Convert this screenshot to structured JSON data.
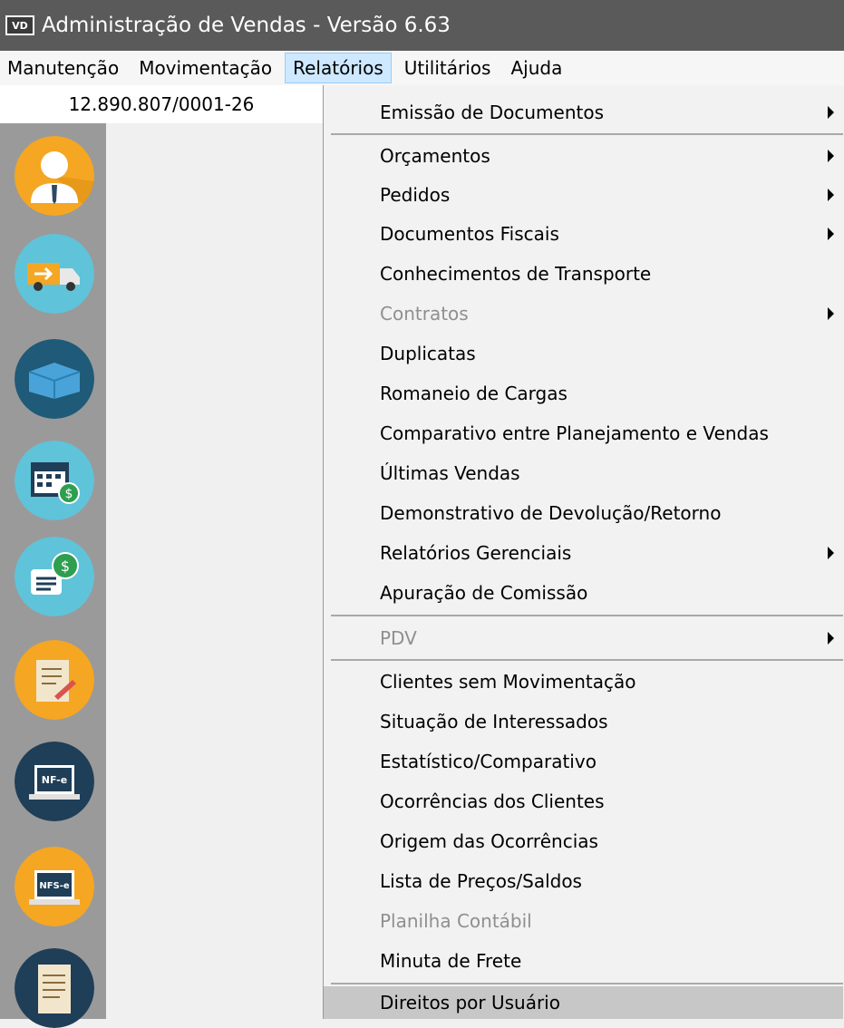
{
  "window": {
    "app_icon": "VD",
    "title": "Administração de Vendas - Versão 6.63"
  },
  "menubar": {
    "items": [
      "Manutenção",
      "Movimentação",
      "Relatórios",
      "Utilitários",
      "Ajuda"
    ],
    "active": "Relatórios"
  },
  "company": {
    "cnpj": "12.890.807/0001-26"
  },
  "sidebar": {
    "icons": [
      "user-icon",
      "delivery-truck-icon",
      "box-icon",
      "calendar-money-icon",
      "invoice-money-icon",
      "document-sign-icon",
      "nfe-laptop-icon",
      "nfse-laptop-icon",
      "document-sheet-icon"
    ],
    "nfe_label": "NF-e",
    "nfse_label": "NFS-e"
  },
  "dropdown": {
    "items": [
      {
        "label": "Emissão de Documentos",
        "submenu": true
      },
      {
        "label": "Orçamentos",
        "submenu": true
      },
      {
        "label": "Pedidos",
        "submenu": true
      },
      {
        "label": "Documentos Fiscais",
        "submenu": true
      },
      {
        "label": "Conhecimentos de Transporte",
        "submenu": false
      },
      {
        "label": "Contratos",
        "submenu": true,
        "disabled": true
      },
      {
        "label": "Duplicatas",
        "submenu": false
      },
      {
        "label": "Romaneio de Cargas",
        "submenu": false
      },
      {
        "label": "Comparativo entre Planejamento e Vendas",
        "submenu": false
      },
      {
        "label": "Últimas Vendas",
        "submenu": false
      },
      {
        "label": "Demonstrativo de Devolução/Retorno",
        "submenu": false
      },
      {
        "label": "Relatórios Gerenciais",
        "submenu": true
      },
      {
        "label": "Apuração de Comissão",
        "submenu": false
      },
      {
        "label": "PDV",
        "submenu": true,
        "disabled": true
      },
      {
        "label": "Clientes sem Movimentação",
        "submenu": false
      },
      {
        "label": "Situação de Interessados",
        "submenu": false
      },
      {
        "label": "Estatístico/Comparativo",
        "submenu": false
      },
      {
        "label": "Ocorrências dos Clientes",
        "submenu": false
      },
      {
        "label": "Origem das Ocorrências",
        "submenu": false
      },
      {
        "label": "Lista de Preços/Saldos",
        "submenu": false
      },
      {
        "label": "Planilha Contábil",
        "submenu": false,
        "disabled": true
      },
      {
        "label": "Minuta de Frete",
        "submenu": false
      },
      {
        "label": "Direitos por Usuário",
        "submenu": false,
        "hovered": true
      }
    ]
  }
}
